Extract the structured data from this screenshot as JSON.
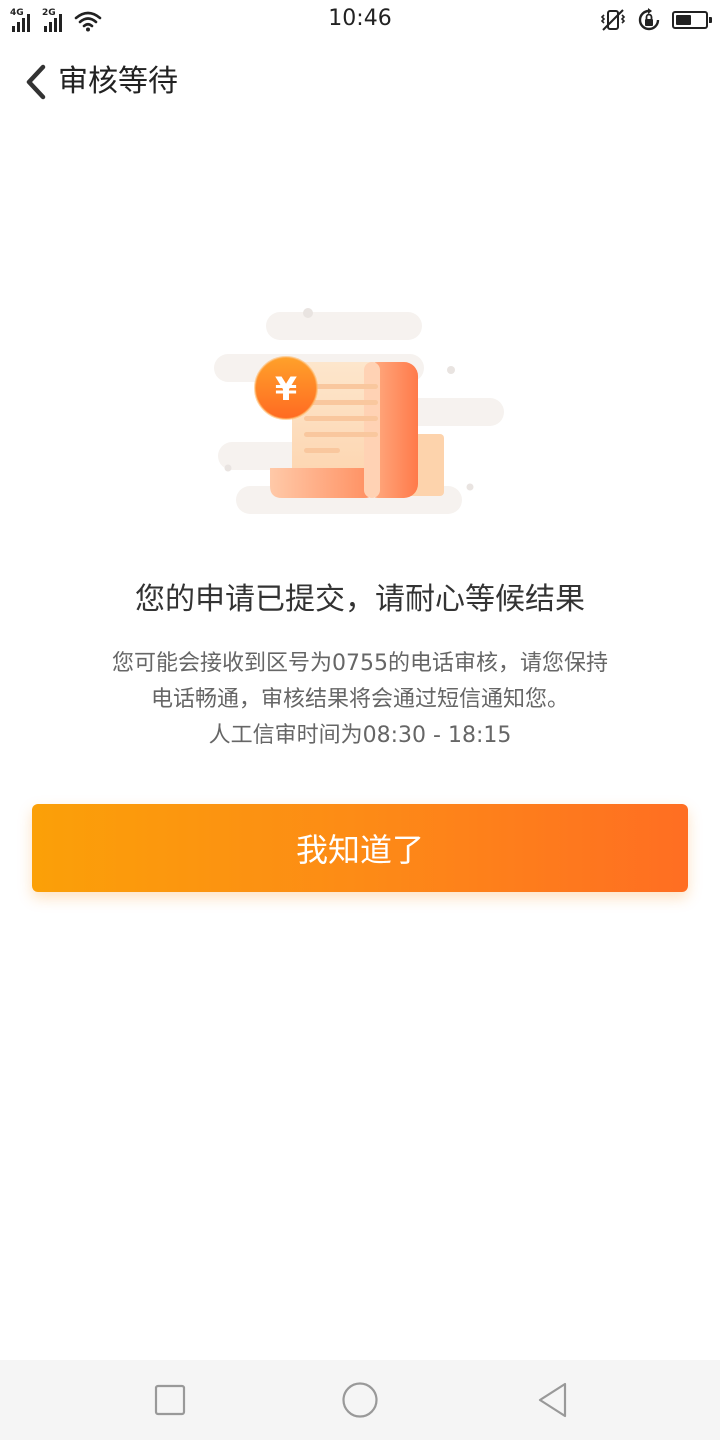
{
  "status_bar": {
    "time": "10:46",
    "network_1": "4G",
    "network_2": "2G",
    "icons": [
      "signal-icon",
      "wifi-icon",
      "vibrate-icon",
      "rotation-lock-icon",
      "battery-icon"
    ],
    "battery_level_percent": 55
  },
  "header": {
    "title": "审核等待",
    "back_icon": "chevron-left-icon"
  },
  "illustration": {
    "coin_symbol": "¥",
    "icon": "receipt-scroll-icon"
  },
  "content": {
    "message": "您的申请已提交，请耐心等候结果",
    "description_lines": [
      "您可能会接收到区号为0755的电话审核，请您保持",
      "电话畅通，审核结果将会通过短信通知您。",
      "人工信审时间为08:30 - 18:15"
    ]
  },
  "actions": {
    "confirm_label": "我知道了"
  },
  "nav_bar": {
    "icons": [
      "square-recent-icon",
      "circle-home-icon",
      "triangle-back-icon"
    ]
  },
  "colors": {
    "button_start": "#fba008",
    "button_end": "#ff6e22",
    "text_primary": "#333333",
    "text_secondary": "#666666",
    "nav_bg": "#f5f5f5"
  }
}
